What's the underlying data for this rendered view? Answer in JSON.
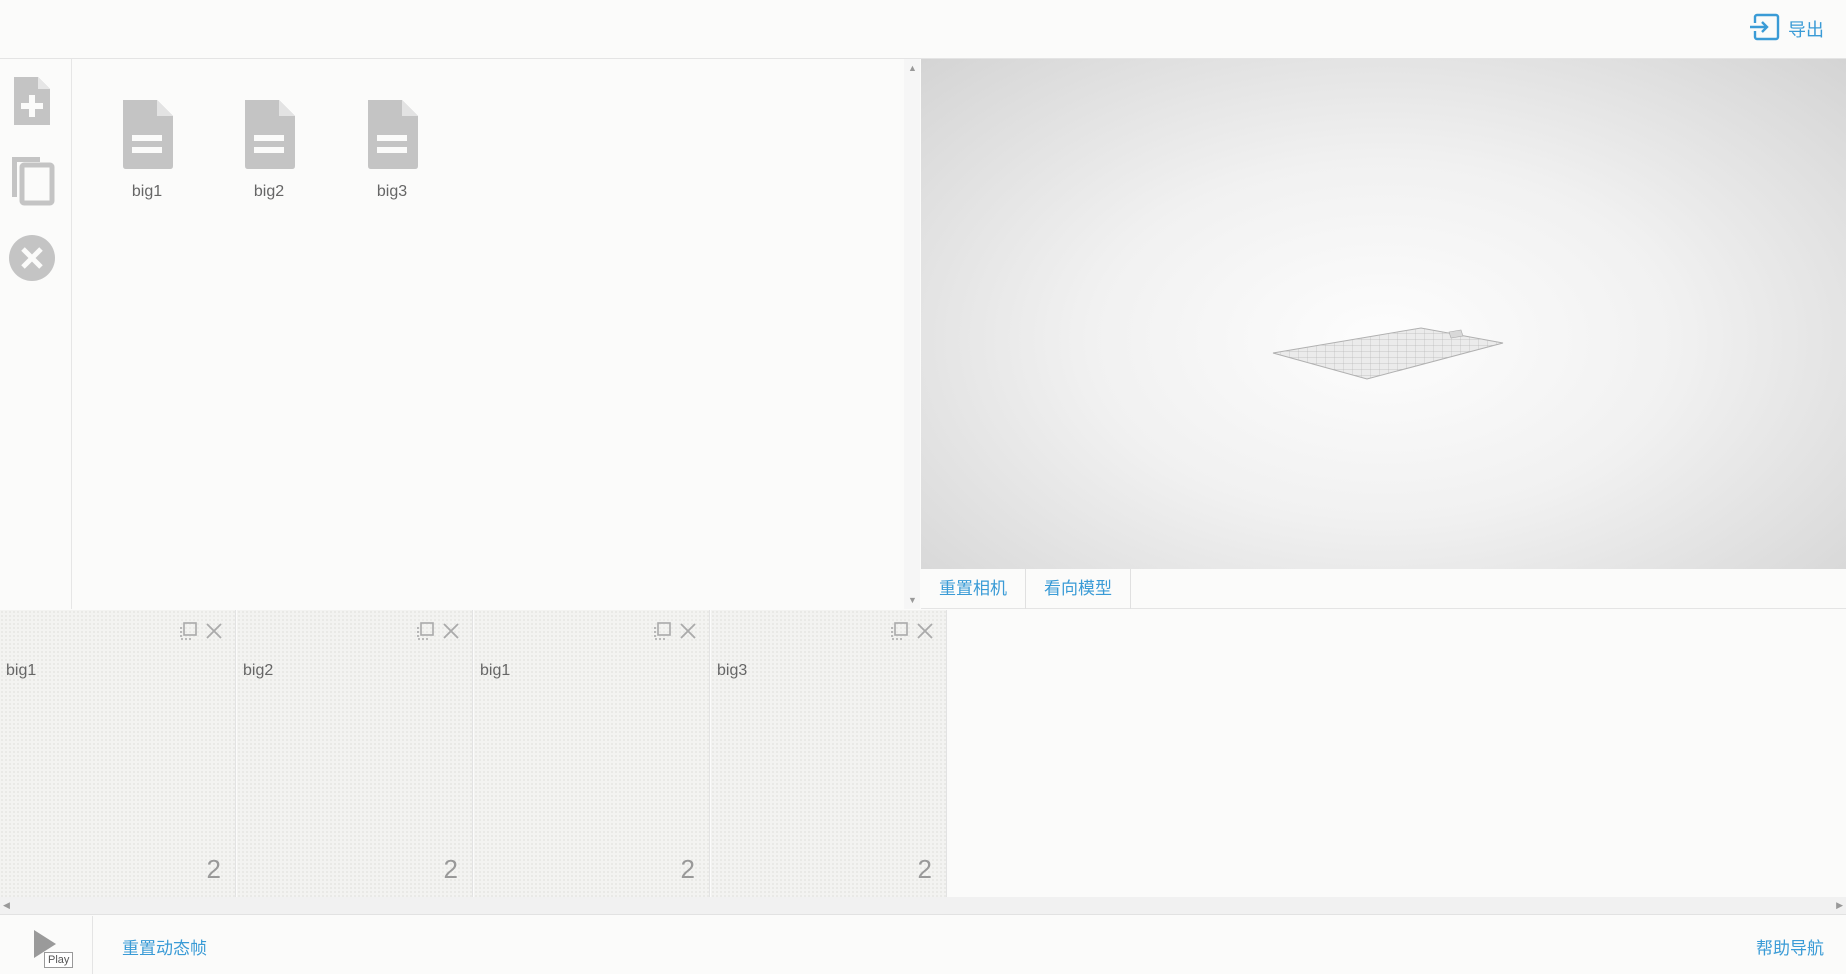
{
  "header": {
    "export_label": "导出",
    "export_icon": "export-icon"
  },
  "toolbar": {
    "tools": [
      {
        "icon": "new-file-icon"
      },
      {
        "icon": "copy-icon"
      },
      {
        "icon": "close-circle-icon"
      }
    ]
  },
  "files": [
    {
      "name": "big1",
      "icon": "document-icon"
    },
    {
      "name": "big2",
      "icon": "document-icon"
    },
    {
      "name": "big3",
      "icon": "document-icon"
    }
  ],
  "viewport": {
    "reset_camera_label": "重置相机",
    "look_at_model_label": "看向模型"
  },
  "frames": [
    {
      "name": "big1",
      "count": "2"
    },
    {
      "name": "big2",
      "count": "2"
    },
    {
      "name": "big1",
      "count": "2"
    },
    {
      "name": "big3",
      "count": "2"
    }
  ],
  "footer": {
    "play_tooltip": "Play",
    "reset_frames_label": "重置动态帧",
    "help_label": "帮助导航"
  },
  "colors": {
    "accent": "#3a9bd6",
    "icon_gray": "#c4c4c4",
    "background": "#fbfbfa"
  }
}
